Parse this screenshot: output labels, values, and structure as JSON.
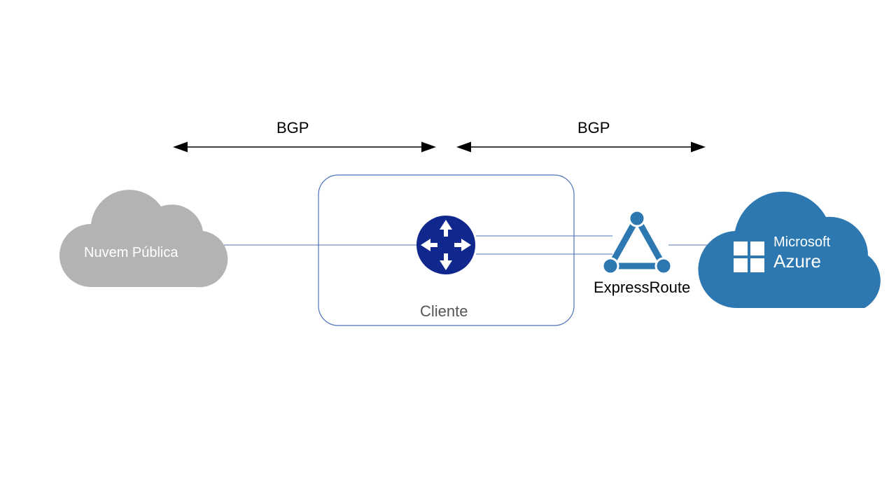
{
  "labels": {
    "bgp_left": "BGP",
    "bgp_right": "BGP",
    "public_cloud": "Nuvem Pública",
    "customer": "Cliente",
    "expressroute": "ExpressRoute",
    "azure_line1": "Microsoft",
    "azure_line2": "Azure"
  },
  "colors": {
    "grey_cloud": "#B3B3B3",
    "azure_blue": "#2E78B1",
    "router_blue": "#10288D",
    "line_blue": "#4E73B8",
    "black": "#000000",
    "white": "#FFFFFF"
  },
  "icons": {
    "grey_cloud": "cloud-icon",
    "router": "router-icon",
    "expressroute": "expressroute-icon",
    "azure_cloud": "azure-cloud-icon",
    "azure_logo": "windows-logo-icon"
  }
}
